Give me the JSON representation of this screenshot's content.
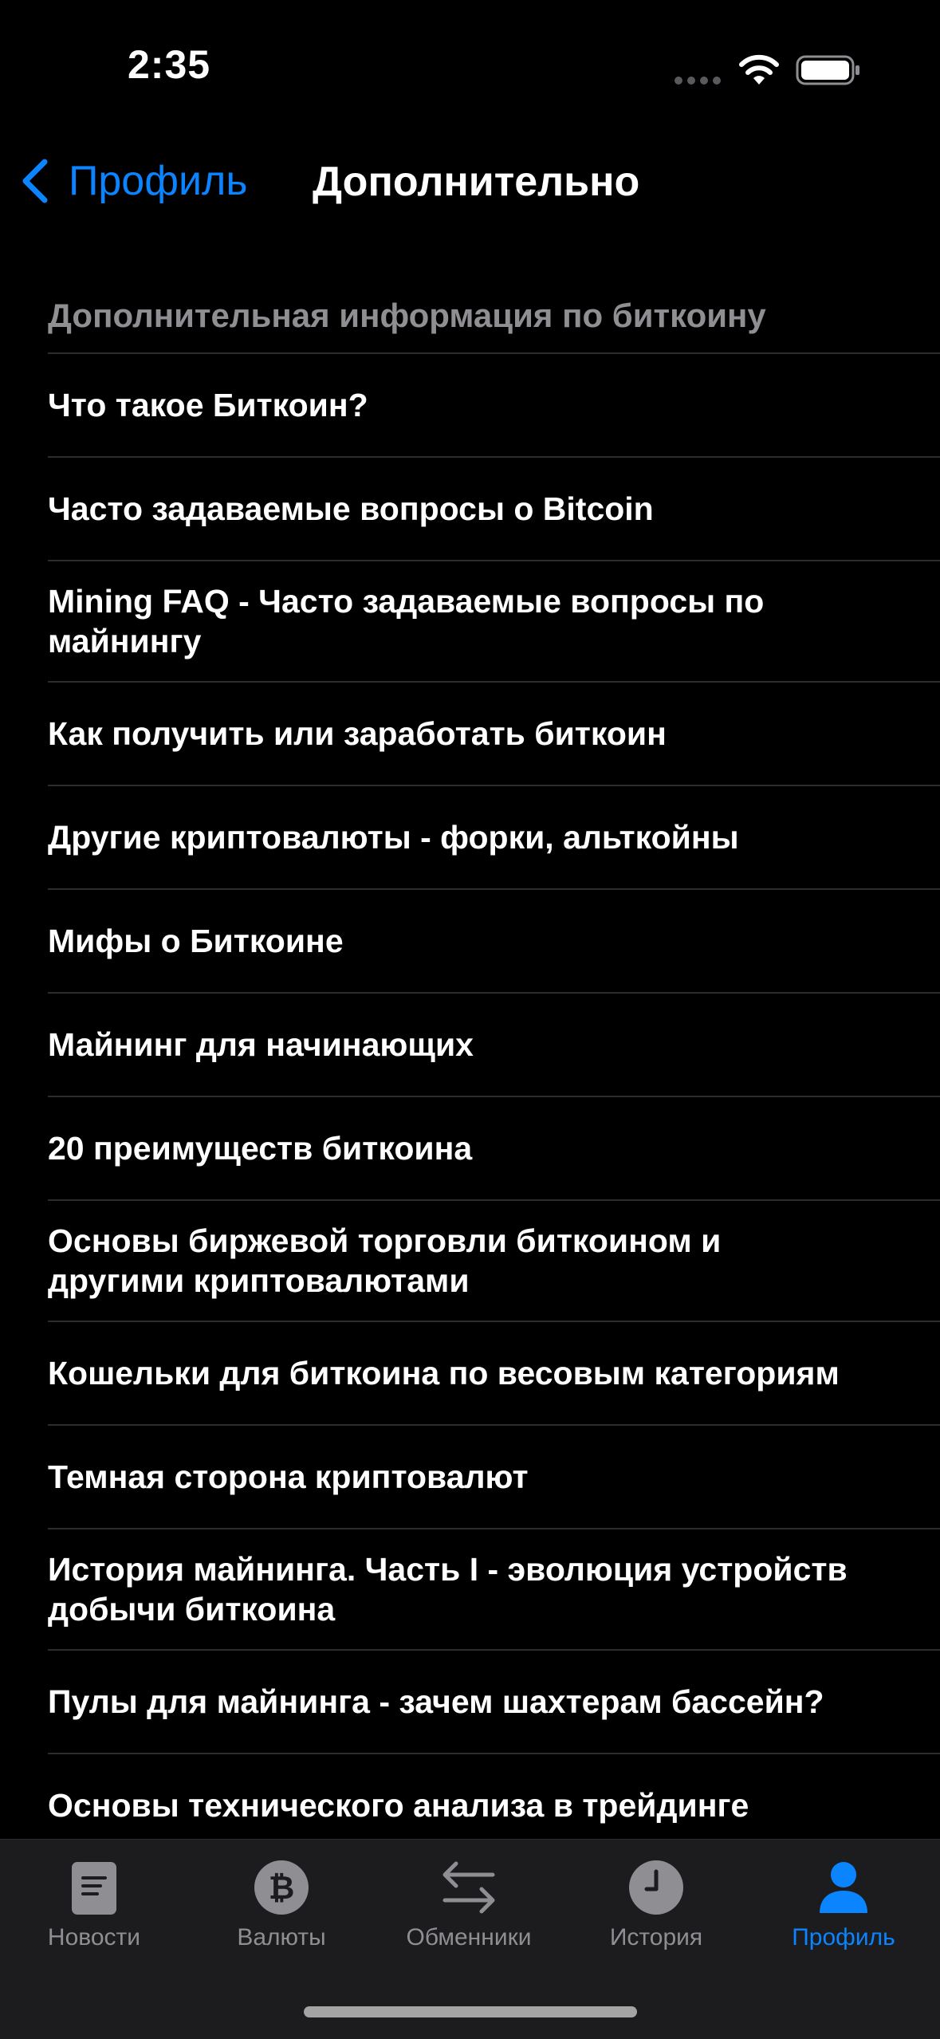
{
  "status_bar": {
    "time": "2:35"
  },
  "nav": {
    "back_label": "Профиль",
    "title": "Дополнительно"
  },
  "section": {
    "header": "Дополнительная информация по биткоину",
    "items": [
      {
        "label": "Что такое Биткоин?"
      },
      {
        "label": "Часто задаваемые вопросы о Bitcoin"
      },
      {
        "label": "Mining FAQ - Часто задаваемые вопросы по майнингу"
      },
      {
        "label": "Как получить или заработать биткоин"
      },
      {
        "label": "Другие криптовалюты - форки, альткойны"
      },
      {
        "label": "Мифы о Биткоине"
      },
      {
        "label": "Майнинг для начинающих"
      },
      {
        "label": "20 преимуществ биткоина"
      },
      {
        "label": "Основы биржевой торговли биткоином и другими криптовалютами"
      },
      {
        "label": "Кошельки для биткоина по весовым категориям"
      },
      {
        "label": "Темная сторона криптовалют"
      },
      {
        "label": "История майнинга. Часть I - эволюция устройств добычи биткоина"
      },
      {
        "label": "Пулы для майнинга - зачем шахтерам бассейн?"
      },
      {
        "label": "Основы технического анализа в трейдинге"
      }
    ]
  },
  "tab_bar": {
    "tabs": [
      {
        "label": "Новости",
        "icon": "newspaper-icon"
      },
      {
        "label": "Валюты",
        "icon": "bitcoin-icon"
      },
      {
        "label": "Обменники",
        "icon": "exchange-arrows-icon"
      },
      {
        "label": "История",
        "icon": "clock-icon"
      },
      {
        "label": "Профиль",
        "icon": "person-icon"
      }
    ],
    "active_tab": "Профиль"
  },
  "colors": {
    "accent": "#0a84ff",
    "background": "#000000",
    "secondary_text": "#8e8e93",
    "separator": "#2c2c2e",
    "tab_bar_bg": "#1c1c1e"
  }
}
